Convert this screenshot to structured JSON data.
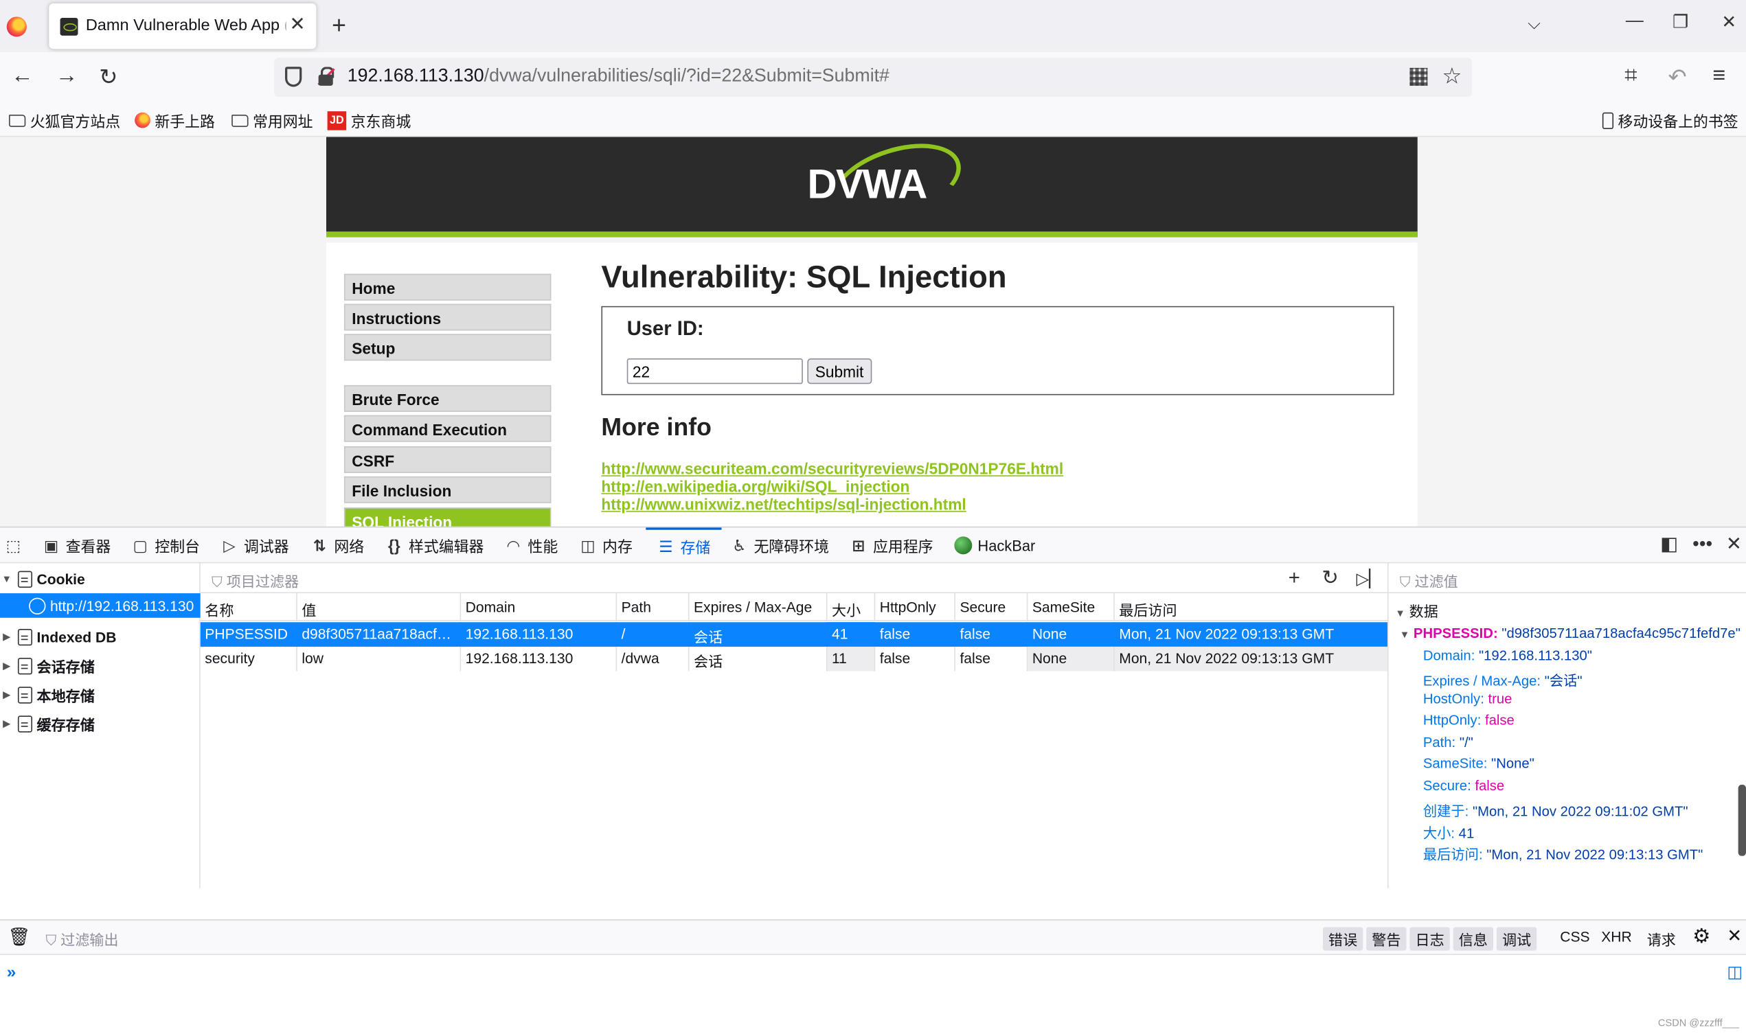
{
  "browser": {
    "tab_title": "Damn Vulnerable Web App",
    "tab_title_fade": " (D",
    "url_host": "192.168.113.130",
    "url_path": "/dvwa/vulnerabilities/sqli/?id=22&Submit=Submit#",
    "bookmarks": [
      "火狐官方站点",
      "新手上路",
      "常用网址",
      "京东商城"
    ],
    "mobile_bookmarks": "移动设备上的书签",
    "icons": [
      "back-arrow-icon",
      "forward-arrow-icon",
      "reload-icon",
      "shield-icon",
      "lock-icon",
      "qr-code-icon",
      "star-icon",
      "crop-icon",
      "undo-icon",
      "menu-icon"
    ]
  },
  "page": {
    "logo": "DVWA",
    "menu": [
      "Home",
      "Instructions",
      "Setup",
      "Brute Force",
      "Command Execution",
      "CSRF",
      "File Inclusion",
      "SQL Injection"
    ],
    "title": "Vulnerability: SQL Injection",
    "form_label": "User ID:",
    "input_value": "22",
    "submit_label": "Submit",
    "more_info": "More info",
    "links": [
      "http://www.securiteam.com/securityreviews/5DP0N1P76E.html",
      "http://en.wikipedia.org/wiki/SQL_injection",
      "http://www.unixwiz.net/techtips/sql-injection.html"
    ]
  },
  "devtools": {
    "tabs": [
      "查看器",
      "控制台",
      "调试器",
      "网络",
      "样式编辑器",
      "性能",
      "内存",
      "存储",
      "无障碍环境",
      "应用程序",
      "HackBar"
    ],
    "active_tab": "存储",
    "tree": {
      "cookie": "Cookie",
      "cookie_host": "http://192.168.113.130",
      "items": [
        "Indexed DB",
        "会话存储",
        "本地存储",
        "缓存存储"
      ]
    },
    "table_filter": "项目过滤器",
    "columns": [
      "名称",
      "值",
      "Domain",
      "Path",
      "Expires / Max-Age",
      "大小",
      "HttpOnly",
      "Secure",
      "SameSite",
      "最后访问"
    ],
    "rows": [
      [
        "PHPSESSID",
        "d98f305711aa718acfa...",
        "192.168.113.130",
        "/",
        "会话",
        "41",
        "false",
        "false",
        "None",
        "Mon, 21 Nov 2022 09:13:13 GMT"
      ],
      [
        "security",
        "low",
        "192.168.113.130",
        "/dvwa",
        "会话",
        "11",
        "false",
        "false",
        "None",
        "Mon, 21 Nov 2022 09:13:13 GMT"
      ]
    ],
    "sidebar": {
      "filter": "过滤值",
      "section": "数据",
      "main_key": "PHPSESSID",
      "main_value": "\"d98f305711aa718acfa4c95c71fefd7e\"",
      "props": [
        {
          "key": "Domain",
          "value": "\"192.168.113.130\"",
          "type": "s"
        },
        {
          "key": "Expires / Max-Age",
          "value": "\"会话\"",
          "type": "s"
        },
        {
          "key": "HostOnly",
          "value": "true",
          "type": "b"
        },
        {
          "key": "HttpOnly",
          "value": "false",
          "type": "b"
        },
        {
          "key": "Path",
          "value": "\"/\"",
          "type": "s"
        },
        {
          "key": "SameSite",
          "value": "\"None\"",
          "type": "s"
        },
        {
          "key": "Secure",
          "value": "false",
          "type": "b"
        },
        {
          "key": "创建于",
          "value": "\"Mon, 21 Nov 2022 09:11:02 GMT\"",
          "type": "s"
        },
        {
          "key": "大小",
          "value": "41",
          "type": "n"
        },
        {
          "key": "最后访问",
          "value": "\"Mon, 21 Nov 2022 09:13:13 GMT\"",
          "type": "s"
        }
      ]
    },
    "console": {
      "filter": "过滤输出",
      "buttons": [
        "错误",
        "警告",
        "日志",
        "信息",
        "调试",
        "CSS",
        "XHR",
        "请求"
      ],
      "watermark": "CSDN @zzzfff___"
    }
  }
}
